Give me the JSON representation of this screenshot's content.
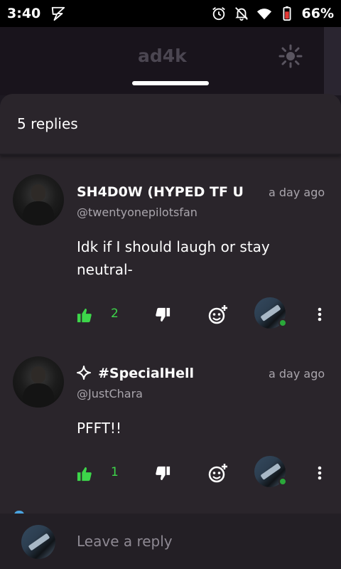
{
  "status_bar": {
    "time": "3:40",
    "battery_percent": "66%",
    "icons": [
      "flash-icon",
      "alarm-icon",
      "notifications-off-icon",
      "wifi-icon",
      "battery-icon"
    ]
  },
  "background_app": {
    "title": "ad4k",
    "icon": "sun-icon"
  },
  "sheet": {
    "replies_label": "5 replies"
  },
  "comments": [
    {
      "username": "SH4D0W (HYPED TF U",
      "handle": "@twentyonepilotsfan",
      "timestamp": "a day ago",
      "text": "Idk if I should laugh or stay neutral-",
      "likes": "2",
      "has_sparkle": false
    },
    {
      "username": "#SpecialHell",
      "handle": "@JustChara",
      "timestamp": "a day ago",
      "text": "PFFT!!",
      "likes": "1",
      "has_sparkle": true
    }
  ],
  "reply_bar": {
    "placeholder": "Leave a reply"
  },
  "colors": {
    "like_green": "#3dd64a",
    "sheet_bg": "#2a252b",
    "muted_text": "#a9a5ac"
  }
}
